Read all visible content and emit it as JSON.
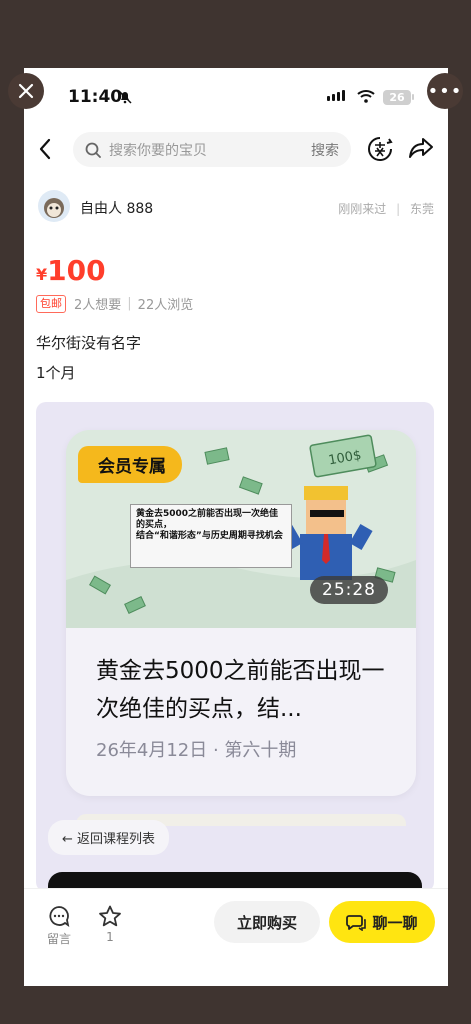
{
  "status_bar": {
    "time": "11:40",
    "battery": "26"
  },
  "nav": {
    "search_placeholder": "搜索你要的宝贝",
    "search_button": "搜索"
  },
  "seller": {
    "name": "自由人 888",
    "last_seen": "刚刚来过",
    "location": "东莞"
  },
  "product": {
    "currency": "¥",
    "price": "100",
    "shipping_tag": "包邮",
    "wants": "2人想要",
    "views": "22人浏览",
    "desc_line1": "华尔街没有名字",
    "desc_line2": "1个月"
  },
  "video": {
    "badge": "会员专属",
    "thumb_text_1": "黄金去5000之前能否出现一次绝佳的买点，",
    "thumb_text_2": "结合“和谐形态”与历史周期寻找机会",
    "money_label": "100$",
    "duration": "25:28",
    "title": "黄金去5000之前能否出现一次绝佳的买点，结...",
    "date": "26年4月12日 · 第六十期",
    "back_link": "← 返回课程列表"
  },
  "bottom_bar": {
    "comment_label": "留言",
    "fav_count": "1",
    "buy_label": "立即购买",
    "chat_label": "聊一聊"
  },
  "colors": {
    "price_red": "#ff3e2b",
    "chat_yellow": "#ffe511",
    "vip_gold": "#f5b81c"
  },
  "icons": [
    "close-icon",
    "more-icon",
    "bell-off-icon",
    "signal-icon",
    "wifi-icon",
    "back-arrow-icon",
    "search-icon",
    "sell-icon",
    "share-icon",
    "comment-icon",
    "star-icon",
    "chat-icon"
  ]
}
